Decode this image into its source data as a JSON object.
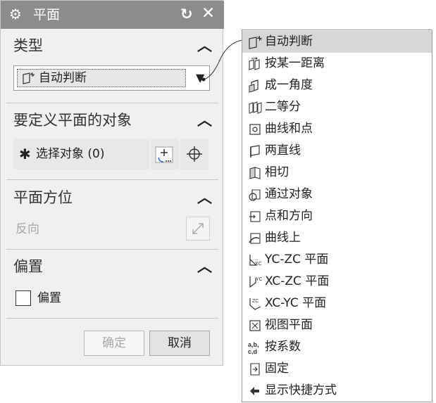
{
  "dialog": {
    "title": "平面",
    "reset_icon": "reset-icon",
    "close_icon": "close-icon",
    "settings_icon": "gear-icon"
  },
  "sections": {
    "type": {
      "header": "类型",
      "selected_value": "自动判断"
    },
    "objects": {
      "header": "要定义平面的对象",
      "select_label": "选择对象 (0)"
    },
    "orientation": {
      "header": "平面方位",
      "reverse_label": "反向"
    },
    "offset": {
      "header": "偏置",
      "checkbox_label": "偏置",
      "checked": false
    }
  },
  "buttons": {
    "ok": "确定",
    "cancel": "取消"
  },
  "dropdown_menu": {
    "items": [
      {
        "label": "自动判断",
        "icon": "inferred-plane-icon",
        "highlighted": true
      },
      {
        "label": "按某一距离",
        "icon": "distance-plane-icon"
      },
      {
        "label": "成一角度",
        "icon": "angle-plane-icon"
      },
      {
        "label": "二等分",
        "icon": "bisector-plane-icon"
      },
      {
        "label": "曲线和点",
        "icon": "curve-point-plane-icon"
      },
      {
        "label": "两直线",
        "icon": "two-lines-plane-icon"
      },
      {
        "label": "相切",
        "icon": "tangent-plane-icon"
      },
      {
        "label": "通过对象",
        "icon": "through-object-plane-icon"
      },
      {
        "label": "点和方向",
        "icon": "point-direction-plane-icon"
      },
      {
        "label": "曲线上",
        "icon": "on-curve-plane-icon"
      },
      {
        "label": "YC-ZC 平面",
        "icon": "yc-zc-plane-icon"
      },
      {
        "label": "XC-ZC 平面",
        "icon": "xc-zc-plane-icon"
      },
      {
        "label": "XC-YC 平面",
        "icon": "xc-yc-plane-icon"
      },
      {
        "label": "视图平面",
        "icon": "view-plane-icon"
      },
      {
        "label": "按系数",
        "icon": "coefficients-plane-icon"
      },
      {
        "label": "固定",
        "icon": "fixed-plane-icon"
      },
      {
        "label": "显示快捷方式",
        "icon": "show-shortcuts-icon"
      }
    ]
  }
}
